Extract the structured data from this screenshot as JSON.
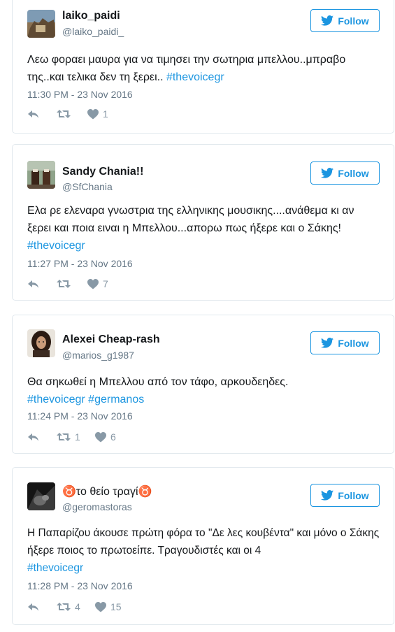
{
  "colors": {
    "link": "#1b95e0",
    "muted": "#657786",
    "icon": "#8899a6",
    "border": "#e1e8ed"
  },
  "follow_label": "Follow",
  "tweets": [
    {
      "name": "laiko_paidi",
      "handle": "@laiko_paidi_",
      "text": "Λεω φοραει μαυρα για να τιμησει την σωτηρια μπελλου..μπραβο της..και τελικα δεν τη ξερει.. ",
      "hashtags": [
        "#thevoicegr"
      ],
      "timestamp": "11:30 PM - 23 Nov 2016",
      "retweets": "",
      "likes": "1"
    },
    {
      "name": "Sandy Chania!!",
      "handle": "@SfChania",
      "text": "Ελα ρε ελεναρα γνωστρια της ελληνικης μουσικης....ανάθεμα κι αν ξερει και ποια ειναι η Μπελλου...απορω πως ήξερε και ο Σάκης! ",
      "hashtags": [
        "#thevoicegr"
      ],
      "timestamp": "11:27 PM - 23 Nov 2016",
      "retweets": "",
      "likes": "7"
    },
    {
      "name": "Alexei Cheap-rash",
      "handle": "@marios_g1987",
      "text": "Θα σηκωθεί η Μπελλου από τον τάφο, αρκουδεηδες. ",
      "hashtags": [
        "#thevoicegr",
        "#germanos"
      ],
      "timestamp": "11:24 PM - 23 Nov 2016",
      "retweets": "1",
      "likes": "6"
    },
    {
      "name": "♉το θείο τραγί♉",
      "handle": "@geromastoras",
      "text": "Η Παπαρίζου άκουσε πρώτη φόρα το \"Δε λες κουβέντα\" και μόνο ο Σάκης ήξερε ποιος το πρωτοείπε. Τραγουδιστές και οι 4 ",
      "hashtags": [
        "#thevoicegr"
      ],
      "timestamp": "11:28 PM - 23 Nov 2016",
      "retweets": "4",
      "likes": "15"
    }
  ]
}
